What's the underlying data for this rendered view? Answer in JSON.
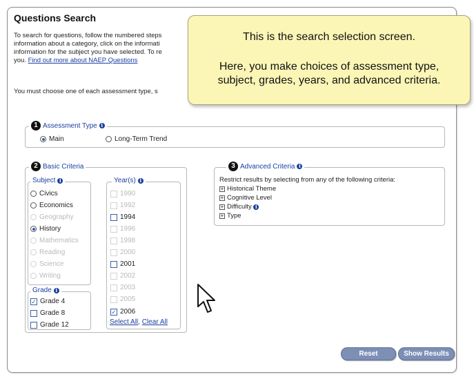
{
  "page_title": "Questions Search",
  "intro_text": "To search for questions, follow the numbered steps\ninformation about a category, click on the informati\ninformation for the subject you have selected. To re\nyou. ",
  "intro_link": "Find out more about NAEP Questions",
  "must_choose": "You must choose one of each assessment type, s",
  "tooltip": {
    "line1": "This is the search selection screen.",
    "line2": "Here, you make choices of assessment type,\nsubject, grades, years, and advanced criteria."
  },
  "assessment": {
    "step": "1",
    "label": "Assessment Type",
    "options": [
      {
        "label": "Main",
        "selected": true
      },
      {
        "label": "Long-Term Trend",
        "selected": false
      }
    ]
  },
  "basic": {
    "step": "2",
    "label": "Basic Criteria",
    "subject_label": "Subject",
    "subjects": [
      {
        "label": "Civics",
        "enabled": true,
        "selected": false
      },
      {
        "label": "Economics",
        "enabled": true,
        "selected": false
      },
      {
        "label": "Geography",
        "enabled": false,
        "selected": false
      },
      {
        "label": "History",
        "enabled": true,
        "selected": true
      },
      {
        "label": "Mathematics",
        "enabled": false,
        "selected": false
      },
      {
        "label": "Reading",
        "enabled": false,
        "selected": false
      },
      {
        "label": "Science",
        "enabled": false,
        "selected": false
      },
      {
        "label": "Writing",
        "enabled": false,
        "selected": false
      }
    ],
    "grade_label": "Grade",
    "grades": [
      {
        "label": "Grade 4",
        "checked": true
      },
      {
        "label": "Grade 8",
        "checked": false
      },
      {
        "label": "Grade 12",
        "checked": false
      }
    ],
    "years_label": "Year(s)",
    "years": [
      {
        "label": "1990",
        "enabled": false,
        "checked": false
      },
      {
        "label": "1992",
        "enabled": false,
        "checked": false
      },
      {
        "label": "1994",
        "enabled": true,
        "checked": false
      },
      {
        "label": "1996",
        "enabled": false,
        "checked": false
      },
      {
        "label": "1998",
        "enabled": false,
        "checked": false
      },
      {
        "label": "2000",
        "enabled": false,
        "checked": false
      },
      {
        "label": "2001",
        "enabled": true,
        "checked": false
      },
      {
        "label": "2002",
        "enabled": false,
        "checked": false
      },
      {
        "label": "2003",
        "enabled": false,
        "checked": false
      },
      {
        "label": "2005",
        "enabled": false,
        "checked": false
      },
      {
        "label": "2006",
        "enabled": true,
        "checked": true
      }
    ],
    "select_all": "Select All",
    "clear_all": "Clear All",
    "comma": ", "
  },
  "advanced": {
    "step": "3",
    "label": "Advanced Criteria",
    "description": "Restrict results by selecting from any of the following criteria:",
    "items": [
      "Historical Theme",
      "Cognitive Level",
      "Difficulty",
      "Type"
    ]
  },
  "buttons": {
    "reset": "Reset",
    "show_results": "Show Results"
  },
  "icons": {
    "info": "i",
    "expand": "+",
    "check": "✓"
  },
  "colors": {
    "link": "#1a3fa0",
    "tooltip_bg": "#fbf6b6",
    "button": "#7e8fb6"
  }
}
